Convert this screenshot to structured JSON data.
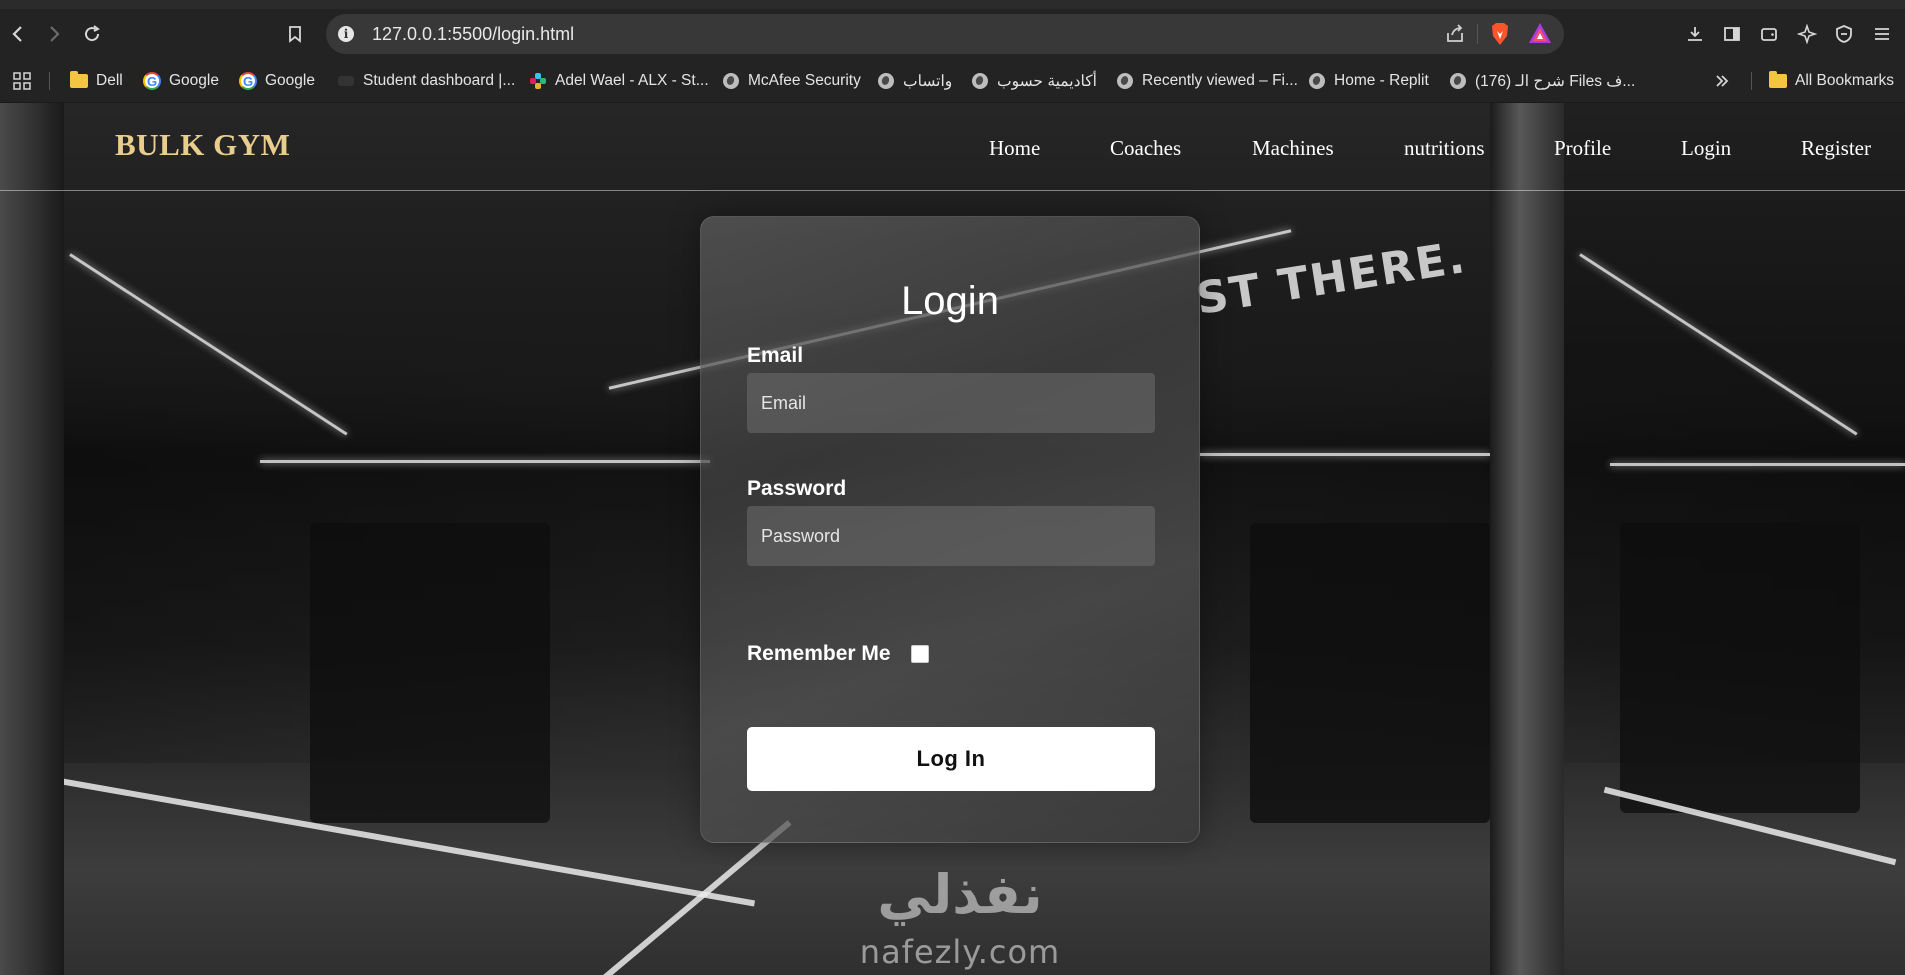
{
  "browser": {
    "url": "127.0.0.1:5500/login.html",
    "bookmarks": [
      {
        "label": "Dell",
        "icon": "folder-icon"
      },
      {
        "label": "Google",
        "icon": "google-icon"
      },
      {
        "label": "Google",
        "icon": "google-icon"
      },
      {
        "label": "Student dashboard |...",
        "icon": "dashboard-icon"
      },
      {
        "label": "Adel Wael - ALX - St...",
        "icon": "slack-icon"
      },
      {
        "label": "McAfee Security",
        "icon": "globe-icon"
      },
      {
        "label": "واتساب",
        "icon": "globe-icon"
      },
      {
        "label": "أكاديمية حسوب",
        "icon": "globe-icon"
      },
      {
        "label": "Recently viewed – Fi...",
        "icon": "globe-icon"
      },
      {
        "label": "Home - Replit",
        "icon": "globe-icon"
      },
      {
        "label": "(176) شرح الـ Files ف...",
        "icon": "globe-icon"
      }
    ],
    "all_bookmarks_label": "All Bookmarks"
  },
  "site": {
    "brand": "BULK GYM",
    "brand_color": "#e9cd8d",
    "nav": [
      "Home",
      "Coaches",
      "Machines",
      "nutritions",
      "Profile",
      "Login",
      "Register"
    ],
    "background_wall_text": "ST THERE."
  },
  "login": {
    "title": "Login",
    "email_label": "Email",
    "email_placeholder": "Email",
    "password_label": "Password",
    "password_placeholder": "Password",
    "remember_label": "Remember Me",
    "remember_checked": false,
    "submit_label": "Log In"
  },
  "watermark": {
    "arabic": "نفذلي",
    "latin": "nafezly.com"
  }
}
